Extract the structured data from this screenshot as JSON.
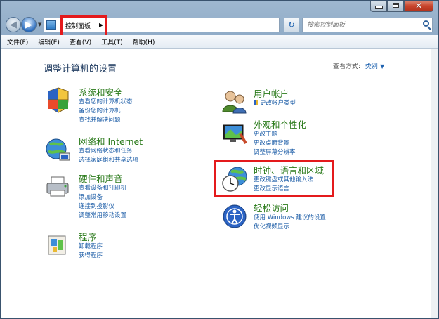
{
  "window": {
    "caption_buttons": [
      "minimize-icon",
      "maximize-icon",
      "close-icon"
    ]
  },
  "nav": {
    "breadcrumb": "控制面板",
    "search_placeholder": "搜索控制面板"
  },
  "menu": [
    "文件(F)",
    "编辑(E)",
    "查看(V)",
    "工具(T)",
    "帮助(H)"
  ],
  "page": {
    "title": "调整计算机的设置",
    "view_by_label": "查看方式:",
    "view_by_value": "类别"
  },
  "categories": {
    "system": {
      "title": "系统和安全",
      "icon": "shield-icon",
      "links": [
        "查看您的计算机状态",
        "备份您的计算机",
        "查找并解决问题"
      ]
    },
    "network": {
      "title": "网络和 Internet",
      "icon": "globe-network-icon",
      "links": [
        "查看网络状态和任务",
        "选择家庭组和共享选项"
      ]
    },
    "hardware": {
      "title": "硬件和声音",
      "icon": "printer-icon",
      "links": [
        "查看设备和打印机",
        "添加设备",
        "连接到投影仪",
        "调整常用移动设置"
      ]
    },
    "programs": {
      "title": "程序",
      "icon": "programs-icon",
      "links": [
        "卸载程序",
        "获得程序"
      ]
    },
    "user": {
      "title": "用户帐户",
      "icon": "users-icon",
      "links": [
        "更改帐户类型"
      ]
    },
    "appearance": {
      "title": "外观和个性化",
      "icon": "display-icon",
      "links": [
        "更改主题",
        "更改桌面背景",
        "调整屏幕分辨率"
      ]
    },
    "clock": {
      "title": "时钟、语言和区域",
      "icon": "clock-globe-icon",
      "links": [
        "更改键盘或其他输入法",
        "更改显示语言"
      ]
    },
    "ease": {
      "title": "轻松访问",
      "icon": "ease-of-access-icon",
      "links": [
        "使用 Windows 建议的设置",
        "优化视频显示"
      ]
    }
  },
  "colors": {
    "category_title": "#2a7a1a",
    "link": "#1f5fa8",
    "highlight": "#e41a1c"
  }
}
